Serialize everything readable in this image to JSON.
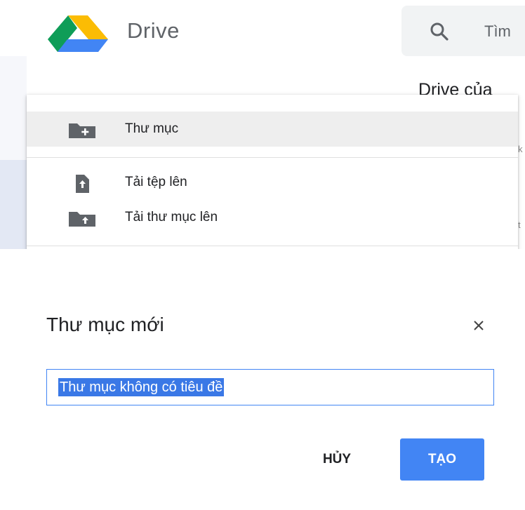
{
  "header": {
    "app_title": "Drive",
    "search_text": "Tìm",
    "drive_heading": "Drive của",
    "bg_fragments": [
      "k",
      "t"
    ]
  },
  "new_menu": {
    "items": [
      {
        "label": "Thư mục",
        "icon": "new-folder-icon"
      },
      {
        "label": "Tải tệp lên",
        "icon": "file-upload-icon"
      },
      {
        "label": "Tải thư mục lên",
        "icon": "folder-upload-icon"
      }
    ]
  },
  "dialog": {
    "title": "Thư mục mới",
    "close_icon": "close-icon",
    "input_value": "Thư mục không có tiêu đề",
    "cancel_label": "HỦY",
    "create_label": "TẠO"
  },
  "colors": {
    "accent": "#4285f4",
    "selection": "#3a78e6",
    "icon_gray": "#5f6368"
  }
}
